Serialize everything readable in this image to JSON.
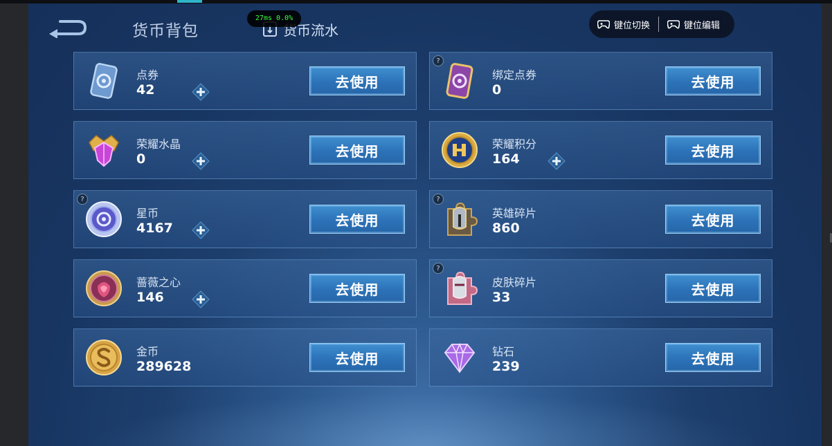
{
  "header": {
    "wallet_tab": "货币背包",
    "flow_tab": "货币流水",
    "fps_overlay": "27ms  0.0%",
    "key_switch": "键位切换",
    "key_edit": "键位编辑"
  },
  "currencies": [
    {
      "name": "点券",
      "amount": "42",
      "button": "去使用",
      "icon": "voucher-card-icon",
      "has_plus": true,
      "has_help": false
    },
    {
      "name": "绑定点券",
      "amount": "0",
      "button": "去使用",
      "icon": "bound-voucher-card-icon",
      "has_plus": false,
      "has_help": true
    },
    {
      "name": "荣耀水晶",
      "amount": "0",
      "button": "去使用",
      "icon": "glory-crystal-icon",
      "has_plus": true,
      "has_help": false
    },
    {
      "name": "荣耀积分",
      "amount": "164",
      "button": "去使用",
      "icon": "glory-points-icon",
      "has_plus": true,
      "has_help": false
    },
    {
      "name": "星币",
      "amount": "4167",
      "button": "去使用",
      "icon": "star-coin-icon",
      "has_plus": true,
      "has_help": true
    },
    {
      "name": "英雄碎片",
      "amount": "860",
      "button": "去使用",
      "icon": "hero-fragment-icon",
      "has_plus": false,
      "has_help": true
    },
    {
      "name": "蔷薇之心",
      "amount": "146",
      "button": "去使用",
      "icon": "rose-heart-icon",
      "has_plus": true,
      "has_help": false
    },
    {
      "name": "皮肤碎片",
      "amount": "33",
      "button": "去使用",
      "icon": "skin-fragment-icon",
      "has_plus": false,
      "has_help": true
    },
    {
      "name": "金币",
      "amount": "289628",
      "button": "去使用",
      "icon": "gold-coin-icon",
      "has_plus": false,
      "has_help": false
    },
    {
      "name": "钻石",
      "amount": "239",
      "button": "去使用",
      "icon": "diamond-icon",
      "has_plus": false,
      "has_help": false
    }
  ],
  "help_glyph": "?",
  "colors": {
    "background": "#183561",
    "card": "#2f5a90",
    "button": "#2c72b8",
    "fps_text": "#39ff3d"
  }
}
